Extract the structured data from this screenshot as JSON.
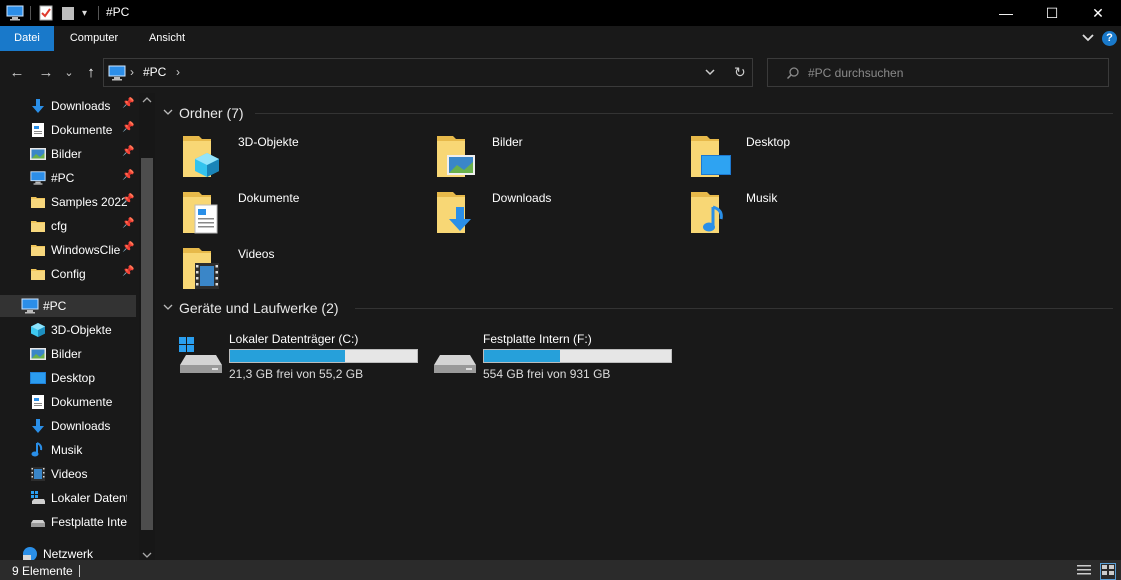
{
  "window": {
    "title": "#PC",
    "minimize_glyph": "—",
    "maximize_glyph": "☐",
    "close_glyph": "✕"
  },
  "ribbon": {
    "tabs": [
      {
        "label": "Datei",
        "active": true
      },
      {
        "label": "Computer",
        "active": false
      },
      {
        "label": "Ansicht",
        "active": false
      }
    ],
    "accent": "#1979ca",
    "help_glyph": "?"
  },
  "navigation": {
    "back_glyph": "←",
    "forward_glyph": "→",
    "recent_glyph": "⌄",
    "up_glyph": "↑",
    "address_path": "#PC",
    "address_separator": "›",
    "refresh_glyph": "↻",
    "search_placeholder": "#PC durchsuchen"
  },
  "sidebar": {
    "quick_access": [
      {
        "label": "Downloads",
        "icon": "downloads-icon",
        "pinned": true
      },
      {
        "label": "Dokumente",
        "icon": "documents-icon",
        "pinned": true
      },
      {
        "label": "Bilder",
        "icon": "pictures-icon",
        "pinned": true
      },
      {
        "label": "#PC",
        "icon": "pc-icon",
        "pinned": true
      },
      {
        "label": "Samples 2022",
        "icon": "folder-icon",
        "pinned": true
      },
      {
        "label": "cfg",
        "icon": "folder-icon",
        "pinned": true
      },
      {
        "label": "WindowsClie",
        "icon": "folder-icon",
        "pinned": true
      },
      {
        "label": "Config",
        "icon": "folder-icon",
        "pinned": true
      }
    ],
    "pc": {
      "label": "#PC",
      "icon": "pc-icon"
    },
    "pc_children": [
      {
        "label": "3D-Objekte",
        "icon": "3d-objects-icon"
      },
      {
        "label": "Bilder",
        "icon": "pictures-icon"
      },
      {
        "label": "Desktop",
        "icon": "desktop-icon"
      },
      {
        "label": "Dokumente",
        "icon": "documents-icon"
      },
      {
        "label": "Downloads",
        "icon": "downloads-icon"
      },
      {
        "label": "Musik",
        "icon": "music-icon"
      },
      {
        "label": "Videos",
        "icon": "videos-icon"
      },
      {
        "label": "Lokaler Datenträ",
        "icon": "windows-drive-icon"
      },
      {
        "label": "Festplatte Intern",
        "icon": "drive-icon"
      }
    ],
    "network": {
      "label": "Netzwerk",
      "icon": "network-icon"
    }
  },
  "content": {
    "folders_heading": "Ordner (7)",
    "folders": [
      {
        "label": "3D-Objekte",
        "icon": "3d-objects-folder-icon"
      },
      {
        "label": "Bilder",
        "icon": "pictures-folder-icon"
      },
      {
        "label": "Desktop",
        "icon": "desktop-folder-icon"
      },
      {
        "label": "Dokumente",
        "icon": "documents-folder-icon"
      },
      {
        "label": "Downloads",
        "icon": "downloads-folder-icon"
      },
      {
        "label": "Musik",
        "icon": "music-folder-icon"
      },
      {
        "label": "Videos",
        "icon": "videos-folder-icon"
      }
    ],
    "drives_heading": "Geräte und Laufwerke (2)",
    "drives": [
      {
        "name": "Lokaler Datenträger (C:)",
        "free_text": "21,3 GB frei von 55,2 GB",
        "used_fraction": 0.614,
        "icon": "windows-drive-icon"
      },
      {
        "name": "Festplatte Intern (F:)",
        "free_text": "554 GB frei von 931 GB",
        "used_fraction": 0.405,
        "icon": "drive-icon"
      }
    ],
    "bar_color": "#26a0da"
  },
  "status": {
    "items_text": "9 Elemente"
  }
}
